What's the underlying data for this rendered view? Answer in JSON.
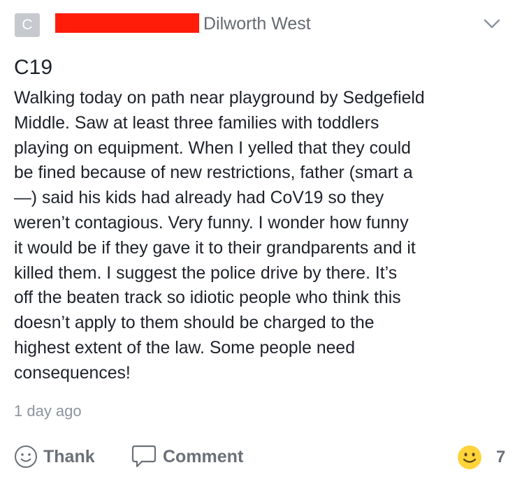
{
  "post": {
    "avatar_initial": "C",
    "neighborhood": "Dilworth West",
    "title": "C19",
    "body_lines": [
      "Walking today on path near playground by Sedgefield",
      "Middle.  Saw at least three families with toddlers",
      "playing on equipment. When I yelled that they could",
      "be fined because of new restrictions, father (smart a",
      "—) said his kids had already had CoV19 so they",
      "weren’t contagious.  Very funny.  I wonder how funny",
      "it would be if they gave it to their grandparents and it",
      "killed them.  I suggest the police drive by there.  It’s",
      "off the beaten track so idiotic people who think this",
      "doesn’t apply to them should be charged to the",
      "highest extent of the law.  Some people need",
      "consequences!"
    ],
    "timestamp": "1 day ago"
  },
  "actions": {
    "thank_label": "Thank",
    "comment_label": "Comment",
    "reaction_count": "7"
  },
  "icons": {
    "thank": "smiley-outline-icon",
    "comment": "speech-bubble-icon",
    "reaction": "smiley-emoji-icon",
    "menu": "chevron-down-icon"
  },
  "colors": {
    "redaction": "#ff1d0a",
    "avatar_bg": "#c6c9cd",
    "muted_text": "#656a70",
    "emoji_yellow": "#ffd43b"
  }
}
